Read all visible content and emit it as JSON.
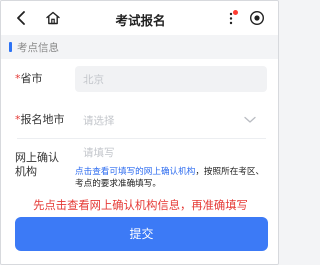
{
  "header": {
    "title": "考试报名",
    "back_icon": "chevron-left-icon",
    "home_icon": "home-icon",
    "more_icon": "more-vertical-icon",
    "target_icon": "target-icon",
    "badge_color": "#ff3b30"
  },
  "section": {
    "title": "考点信息",
    "accent": "#2d73f5"
  },
  "form": {
    "province": {
      "required_mark": "*",
      "label": "省市",
      "value": "北京"
    },
    "city": {
      "required_mark": "*",
      "label": "报名地市",
      "placeholder": "请选择"
    },
    "institution": {
      "label_line1": "网上确认",
      "label_line2": "机构",
      "placeholder": "请填写",
      "hint_link": "点击查看可填写的网上确认机构",
      "hint_rest": "，按照所在考区、考点的要求准确填写。"
    }
  },
  "annotation": {
    "text": "先点击查看网上确认机构信息，再准确填写",
    "color": "#e53935"
  },
  "submit": {
    "label": "提交",
    "color": "#3c7af6"
  }
}
